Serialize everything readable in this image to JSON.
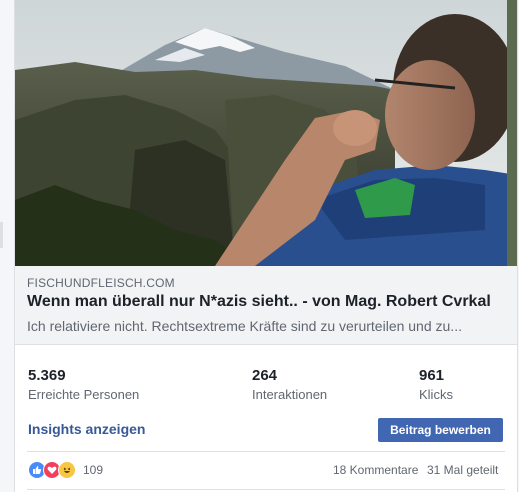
{
  "link_preview": {
    "domain": "FISCHUNDFLEISCH.COM",
    "title": "Wenn man überall nur N*azis sieht.. - von Mag. Robert Cvrkal",
    "description": "Ich relativiere nicht. Rechtsextreme Kräfte sind zu verurteilen und zu..."
  },
  "stats": [
    {
      "value": "5.369",
      "label": "Erreichte Personen"
    },
    {
      "value": "264",
      "label": "Interaktionen"
    },
    {
      "value": "961",
      "label": "Klicks"
    }
  ],
  "actions": {
    "insights_label": "Insights anzeigen",
    "boost_label": "Beitrag bewerben"
  },
  "reactions": {
    "icons": [
      "like-icon",
      "love-icon",
      "haha-icon"
    ],
    "count": "109",
    "comments": "18 Kommentare",
    "shares": "31 Mal geteilt"
  },
  "colors": {
    "link": "#385898",
    "button": "#4267b2",
    "like": "#4a8cf7",
    "love": "#f0405d",
    "haha": "#f7c743"
  }
}
